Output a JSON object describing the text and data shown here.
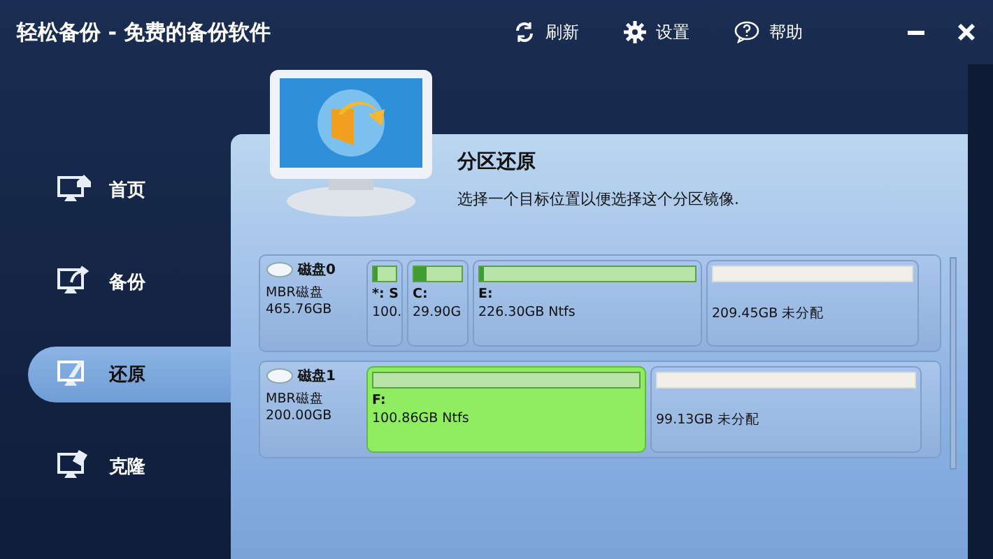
{
  "window": {
    "title": "轻松备份 - 免费的备份软件"
  },
  "toolbar": [
    {
      "kind": "refresh",
      "label": "刷新"
    },
    {
      "kind": "settings",
      "label": "设置"
    },
    {
      "kind": "help",
      "label": "帮助"
    }
  ],
  "sidebar": {
    "items": [
      {
        "kind": "home",
        "label": "首页",
        "selected": false
      },
      {
        "kind": "backup",
        "label": "备份",
        "selected": false
      },
      {
        "kind": "restore",
        "label": "还原",
        "selected": true
      },
      {
        "kind": "clone",
        "label": "克隆",
        "selected": false
      }
    ]
  },
  "header": {
    "title": "分区还原",
    "description": "选择一个目标位置以便选择这个分区镜像."
  },
  "disks": [
    {
      "name": "磁盘0",
      "type": "MBR磁盘",
      "size": "465.76GB",
      "partitions": [
        {
          "kind": "partition",
          "label": "*: S",
          "info": "100.",
          "level": 0.2,
          "selected": false
        },
        {
          "kind": "partition",
          "label": "C:",
          "info": "29.90G",
          "level": 0.25,
          "selected": false
        },
        {
          "kind": "partition",
          "label": "E:",
          "info": "226.30GB Ntfs",
          "level": 0.02,
          "selected": false
        },
        {
          "kind": "unallocated",
          "info": "209.45GB 未分配",
          "selected": false
        }
      ]
    },
    {
      "name": "磁盘1",
      "type": "MBR磁盘",
      "size": "200.00GB",
      "partitions": [
        {
          "kind": "partition",
          "label": "F:",
          "info": "100.86GB Ntfs",
          "selected": true
        },
        {
          "kind": "unallocated",
          "info": "99.13GB 未分配",
          "selected": false
        }
      ]
    }
  ]
}
